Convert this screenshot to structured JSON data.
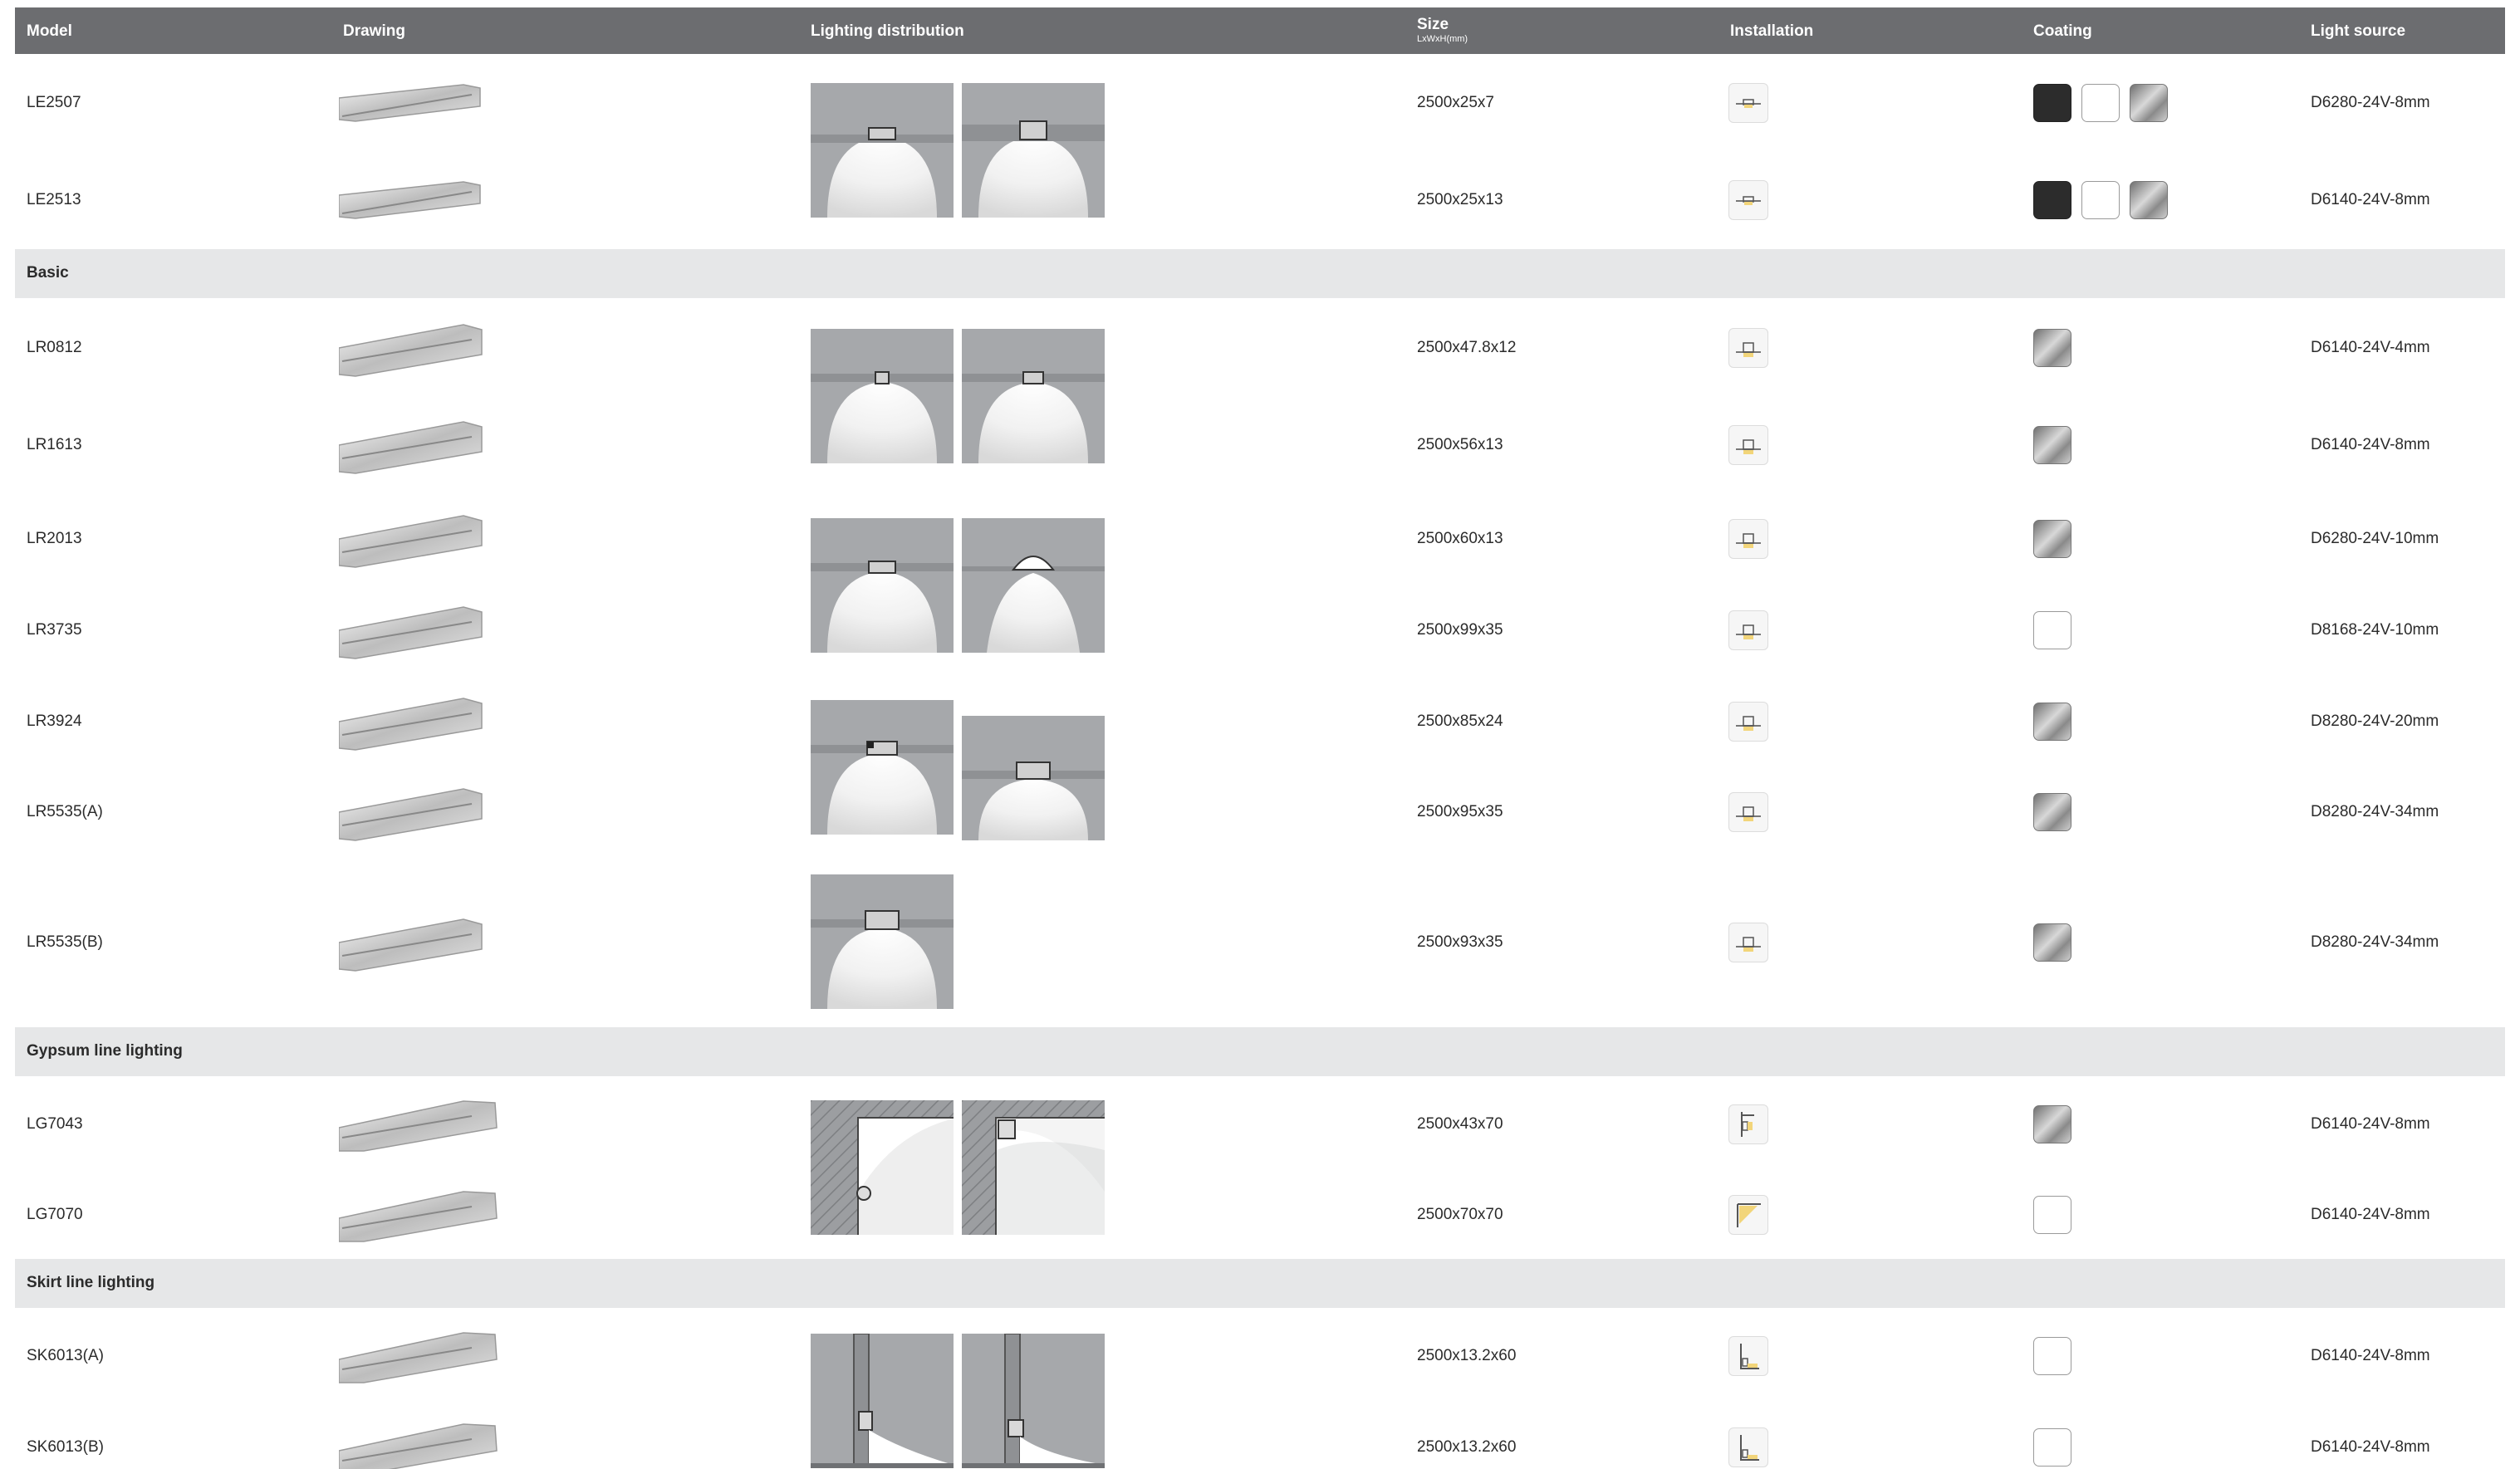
{
  "header": {
    "model": "Model",
    "drawing": "Drawing",
    "lighting": "Lighting distribution",
    "size": "Size",
    "size_unit": "LxWxH(mm)",
    "installation": "Installation",
    "coating": "Coating",
    "light_source": "Light source"
  },
  "sections": {
    "basic": "Basic",
    "gypsum": "Gypsum line lighting",
    "skirt": "Skirt line lighting"
  },
  "rows": [
    {
      "model": "LE2507",
      "size": "2500x25x7",
      "light": "D6280-24V-8mm",
      "coating": [
        "black",
        "white",
        "silver"
      ],
      "installation_icon": "surface-slot-icon"
    },
    {
      "model": "LE2513",
      "size": "2500x25x13",
      "light": "D6140-24V-8mm",
      "coating": [
        "black",
        "white",
        "silver"
      ],
      "installation_icon": "surface-slot-icon"
    },
    {
      "model": "LR0812",
      "size": "2500x47.8x12",
      "light": "D6140-24V-4mm",
      "coating": [
        "silver"
      ],
      "installation_icon": "recessed-icon"
    },
    {
      "model": "LR1613",
      "size": "2500x56x13",
      "light": "D6140-24V-8mm",
      "coating": [
        "silver"
      ],
      "installation_icon": "recessed-icon"
    },
    {
      "model": "LR2013",
      "size": "2500x60x13",
      "light": "D6280-24V-10mm",
      "coating": [
        "silver"
      ],
      "installation_icon": "recessed-icon"
    },
    {
      "model": "LR3735",
      "size": "2500x99x35",
      "light": "D8168-24V-10mm",
      "coating": [
        "white"
      ],
      "installation_icon": "recessed-icon"
    },
    {
      "model": "LR3924",
      "size": "2500x85x24",
      "light": "D8280-24V-20mm",
      "coating": [
        "silver"
      ],
      "installation_icon": "recessed-icon"
    },
    {
      "model": "LR5535(A)",
      "size": "2500x95x35",
      "light": "D8280-24V-34mm",
      "coating": [
        "silver"
      ],
      "installation_icon": "recessed-icon"
    },
    {
      "model": "LR5535(B)",
      "size": "2500x93x35",
      "light": "D8280-24V-34mm",
      "coating": [
        "silver"
      ],
      "installation_icon": "recessed-icon"
    },
    {
      "model": "LG7043",
      "size": "2500x43x70",
      "light": "D6140-24V-8mm",
      "coating": [
        "silver"
      ],
      "installation_icon": "wall-corner-icon"
    },
    {
      "model": "LG7070",
      "size": "2500x70x70",
      "light": "D6140-24V-8mm",
      "coating": [
        "white"
      ],
      "installation_icon": "ceiling-corner-icon"
    },
    {
      "model": "SK6013(A)",
      "size": "2500x13.2x60",
      "light": "D6140-24V-8mm",
      "coating": [
        "white"
      ],
      "installation_icon": "skirting-icon"
    },
    {
      "model": "SK6013(B)",
      "size": "2500x13.2x60",
      "light": "D6140-24V-8mm",
      "coating": [
        "white"
      ],
      "installation_icon": "skirting-icon"
    }
  ],
  "colors": {
    "header_bg": "#6c6d70",
    "section_bg": "#e6e7e8",
    "diagram_gray": "#a6a8ab",
    "led_warm": "#f2d57a"
  }
}
